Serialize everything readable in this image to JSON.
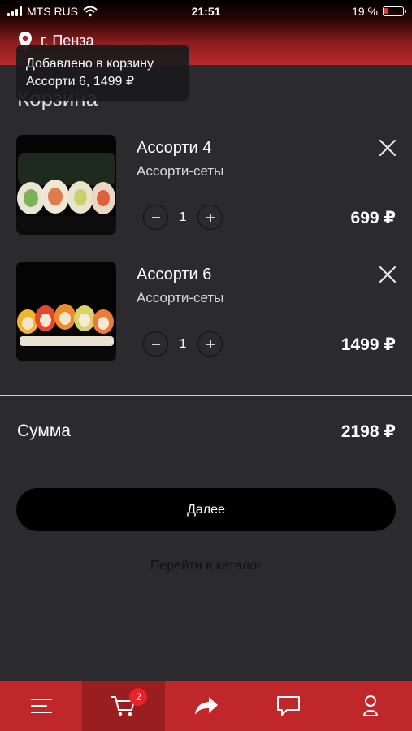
{
  "status_bar": {
    "carrier": "MTS RUS",
    "time": "21:51",
    "battery": "19 %",
    "battery_level": 0.19
  },
  "header": {
    "city": "г. Пенза",
    "icon": "map-pin-icon"
  },
  "toast": {
    "line1": "Добавлено в корзину",
    "line2": "Ассорти 6, 1499 ₽"
  },
  "page": {
    "title": "Корзина"
  },
  "cart": {
    "items": [
      {
        "name": "Ассорти 4",
        "category": "Ассорти-сеты",
        "quantity": "1",
        "price": "699 ₽"
      },
      {
        "name": "Ассорти 6",
        "category": "Ассорти-сеты",
        "quantity": "1",
        "price": "1499 ₽"
      }
    ]
  },
  "summary": {
    "label": "Сумма",
    "total": "2198 ₽"
  },
  "actions": {
    "next": "Далее",
    "catalog": "Перейти в каталог"
  },
  "tabbar": {
    "items": [
      {
        "icon": "menu-icon"
      },
      {
        "icon": "cart-icon",
        "badge": "2",
        "active": true
      },
      {
        "icon": "share-icon"
      },
      {
        "icon": "chat-icon"
      },
      {
        "icon": "profile-icon"
      }
    ]
  },
  "colors": {
    "accent": "#c0272b",
    "background": "#2b2b2d",
    "button": "#000000"
  }
}
